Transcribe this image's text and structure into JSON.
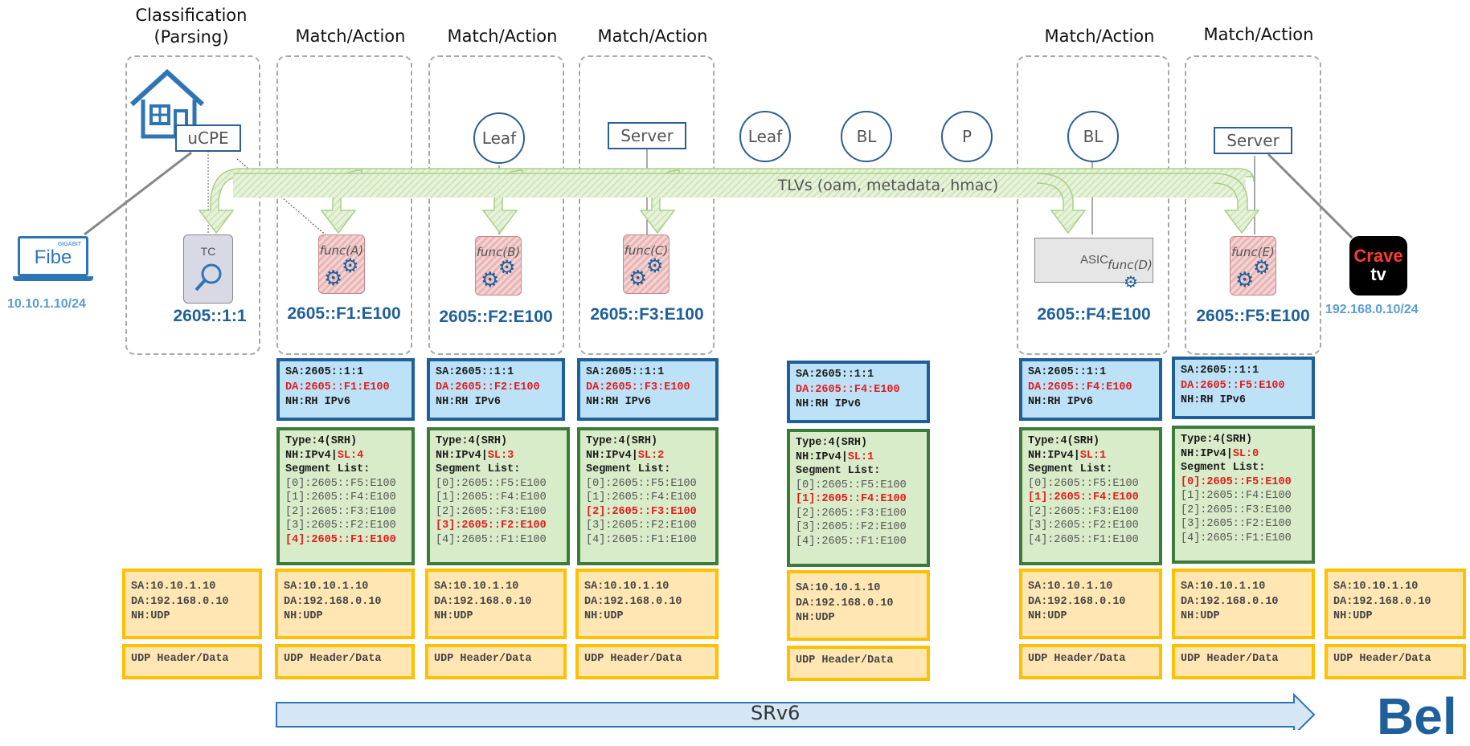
{
  "headers": {
    "classification": [
      "Classification",
      "(Parsing)"
    ],
    "stage1": "Match/Action",
    "stage2": "Match/Action",
    "stage3": "Match/Action",
    "stage4": "Match/Action",
    "stage5": "Match/Action"
  },
  "nodes": {
    "ucpe": "uCPE",
    "leaf1": "Leaf",
    "server1": "Server",
    "leaf2": "Leaf",
    "bl1": "BL",
    "p": "P",
    "bl2": "BL",
    "server2": "Server"
  },
  "tlv_label": "TLVs (oam, metadata, hmac)",
  "endpoints": {
    "left_logo_small": "GIGABIT",
    "left_logo_big": "Fibe",
    "left_ip": "10.10.1.10/24",
    "right_logo_top": "Crave",
    "right_logo_bottom": "tv",
    "right_ip": "192.168.0.10/24",
    "brand_partial": "Bel"
  },
  "functions": {
    "tc": "TC",
    "a": "func(A)",
    "b": "func(B)",
    "c": "func(C)",
    "asic": "ASIC",
    "d": "func(D)",
    "e": "func(E)"
  },
  "addresses": {
    "tc": "2605::1:1",
    "f1": "2605::F1:E100",
    "f2": "2605::F2:E100",
    "f3": "2605::F3:E100",
    "f4": "2605::F4:E100",
    "f5": "2605::F5:E100"
  },
  "ipv6_headers": [
    {
      "sa": "SA:2605::1:1",
      "da": "DA:2605::F1:E100",
      "nh": "NH:RH IPv6"
    },
    {
      "sa": "SA:2605::1:1",
      "da": "DA:2605::F2:E100",
      "nh": "NH:RH IPv6"
    },
    {
      "sa": "SA:2605::1:1",
      "da": "DA:2605::F3:E100",
      "nh": "NH:RH IPv6"
    },
    {
      "sa": "SA:2605::1:1",
      "da": "DA:2605::F4:E100",
      "nh": "NH:RH IPv6"
    },
    {
      "sa": "SA:2605::1:1",
      "da": "DA:2605::F4:E100",
      "nh": "NH:RH IPv6"
    },
    {
      "sa": "SA:2605::1:1",
      "da": "DA:2605::F5:E100",
      "nh": "NH:RH IPv6"
    }
  ],
  "srh_headers": [
    {
      "type": "Type:4(SRH)",
      "nh": "NH:IPv4|",
      "sl": "SL:4",
      "list_label": "Segment List:",
      "segments": [
        "[0]:2605::F5:E100",
        "[1]:2605::F4:E100",
        "[2]:2605::F3:E100",
        "[3]:2605::F2:E100",
        "[4]:2605::F1:E100"
      ],
      "active": 4
    },
    {
      "type": "Type:4(SRH)",
      "nh": "NH:IPv4|",
      "sl": "SL:3",
      "list_label": "Segment List:",
      "segments": [
        "[0]:2605::F5:E100",
        "[1]:2605::F4:E100",
        "[2]:2605::F3:E100",
        "[3]:2605::F2:E100",
        "[4]:2605::F1:E100"
      ],
      "active": 3
    },
    {
      "type": "Type:4(SRH)",
      "nh": "NH:IPv4|",
      "sl": "SL:2",
      "list_label": "Segment List:",
      "segments": [
        "[0]:2605::F5:E100",
        "[1]:2605::F4:E100",
        "[2]:2605::F3:E100",
        "[3]:2605::F2:E100",
        "[4]:2605::F1:E100"
      ],
      "active": 2
    },
    {
      "type": "Type:4(SRH)",
      "nh": "NH:IPv4|",
      "sl": "SL:1",
      "list_label": "Segment List:",
      "segments": [
        "[0]:2605::F5:E100",
        "[1]:2605::F4:E100",
        "[2]:2605::F3:E100",
        "[3]:2605::F2:E100",
        "[4]:2605::F1:E100"
      ],
      "active": 1
    },
    {
      "type": "Type:4(SRH)",
      "nh": "NH:IPv4|",
      "sl": "SL:1",
      "list_label": "Segment List:",
      "segments": [
        "[0]:2605::F5:E100",
        "[1]:2605::F4:E100",
        "[2]:2605::F3:E100",
        "[3]:2605::F2:E100",
        "[4]:2605::F1:E100"
      ],
      "active": 1
    },
    {
      "type": "Type:4(SRH)",
      "nh": "NH:IPv4|",
      "sl": "SL:0",
      "list_label": "Segment List:",
      "segments": [
        "[0]:2605::F5:E100",
        "[1]:2605::F4:E100",
        "[2]:2605::F3:E100",
        "[3]:2605::F2:E100",
        "[4]:2605::F1:E100"
      ],
      "active": 0
    }
  ],
  "ipv4_headers": [
    {
      "sa": "SA:10.10.1.10",
      "da": "DA:192.168.0.10",
      "nh": "NH:UDP"
    },
    {
      "sa": "SA:10.10.1.10",
      "da": "DA:192.168.0.10",
      "nh": "NH:UDP"
    },
    {
      "sa": "SA:10.10.1.10",
      "da": "DA:192.168.0.10",
      "nh": "NH:UDP"
    },
    {
      "sa": "SA:10.10.1.10",
      "da": "DA:192.168.0.10",
      "nh": "NH:UDP"
    },
    {
      "sa": "SA:10.10.1.10",
      "da": "DA:192.168.0.10",
      "nh": "NH:UDP"
    },
    {
      "sa": "SA:10.10.1.10",
      "da": "DA:192.168.0.10",
      "nh": "NH:UDP"
    },
    {
      "sa": "SA:10.10.1.10",
      "da": "DA:192.168.0.10",
      "nh": "NH:UDP"
    },
    {
      "sa": "SA:10.10.1.10",
      "da": "DA:192.168.0.10",
      "nh": "NH:UDP"
    }
  ],
  "udp_label": "UDP Header/Data",
  "srv6_label": "SRv6",
  "colors": {
    "ipv6_fill": "#bde2f7",
    "ipv6_border": "#1f5f9a",
    "srh_fill": "#d9ecc9",
    "srh_border": "#3d7b3b",
    "ipv4_fill": "#ffe6b3",
    "ipv4_border": "#ffc000",
    "active_segment": "#e31b1b",
    "address_text": "#1f5f9a",
    "ip_text": "#5b9bd5"
  }
}
